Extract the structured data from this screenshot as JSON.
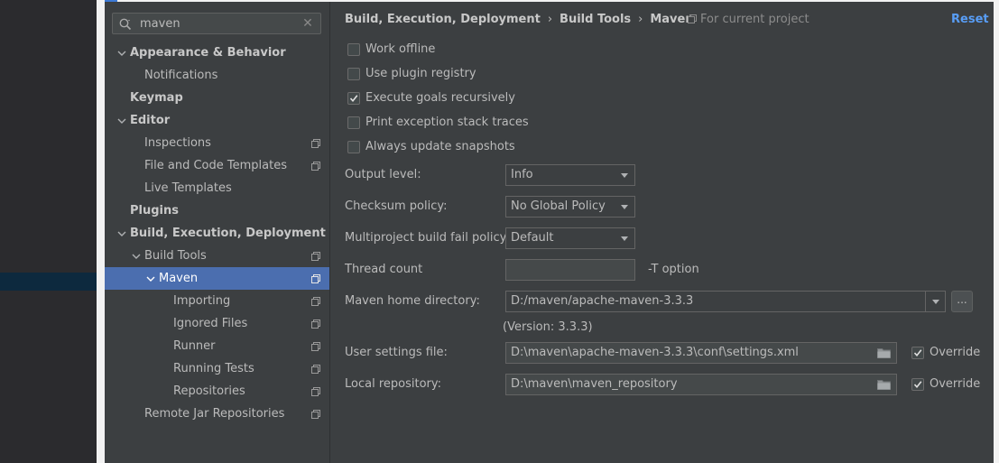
{
  "search": {
    "value": "maven",
    "icon": "search-icon"
  },
  "tree": [
    {
      "label": "Appearance & Behavior",
      "bold": true,
      "expanded": true,
      "depth": 0,
      "shared": false
    },
    {
      "label": "Notifications",
      "bold": false,
      "depth": 1,
      "shared": false
    },
    {
      "label": "Keymap",
      "bold": true,
      "depth": 0,
      "shared": false
    },
    {
      "label": "Editor",
      "bold": true,
      "expanded": true,
      "depth": 0,
      "shared": false
    },
    {
      "label": "Inspections",
      "bold": false,
      "depth": 1,
      "shared": true
    },
    {
      "label": "File and Code Templates",
      "bold": false,
      "depth": 1,
      "shared": true
    },
    {
      "label": "Live Templates",
      "bold": false,
      "depth": 1,
      "shared": false
    },
    {
      "label": "Plugins",
      "bold": true,
      "depth": 0,
      "shared": false
    },
    {
      "label": "Build, Execution, Deployment",
      "bold": true,
      "expanded": true,
      "depth": 0,
      "shared": false
    },
    {
      "label": "Build Tools",
      "bold": false,
      "expanded": true,
      "depth": 1,
      "shared": true
    },
    {
      "label": "Maven",
      "bold": false,
      "expanded": true,
      "depth": 2,
      "shared": true,
      "selected": true
    },
    {
      "label": "Importing",
      "bold": false,
      "depth": 3,
      "shared": true
    },
    {
      "label": "Ignored Files",
      "bold": false,
      "depth": 3,
      "shared": true
    },
    {
      "label": "Runner",
      "bold": false,
      "depth": 3,
      "shared": true
    },
    {
      "label": "Running Tests",
      "bold": false,
      "depth": 3,
      "shared": true
    },
    {
      "label": "Repositories",
      "bold": false,
      "depth": 3,
      "shared": true
    },
    {
      "label": "Remote Jar Repositories",
      "bold": false,
      "depth": 1,
      "shared": true
    }
  ],
  "header": {
    "breadcrumb": [
      "Build, Execution, Deployment",
      "Build Tools",
      "Maven"
    ],
    "for_project": "For current project",
    "reset": "Reset"
  },
  "options": [
    {
      "label": "Work offline",
      "checked": false
    },
    {
      "label": "Use plugin registry",
      "checked": false
    },
    {
      "label": "Execute goals recursively",
      "checked": true
    },
    {
      "label": "Print exception stack traces",
      "checked": false
    },
    {
      "label": "Always update snapshots",
      "checked": false
    }
  ],
  "form": {
    "output_level": {
      "label": "Output level:",
      "value": "Info"
    },
    "checksum_policy": {
      "label": "Checksum policy:",
      "value": "No Global Policy"
    },
    "fail_policy": {
      "label": "Multiproject build fail policy:",
      "value": "Default"
    },
    "thread_count": {
      "label": "Thread count",
      "value": "",
      "suffix": "-T option"
    },
    "maven_home": {
      "label": "Maven home directory:",
      "value": "D:/maven/apache-maven-3.3.3",
      "browse": "...",
      "version": "(Version: 3.3.3)"
    },
    "user_settings": {
      "label": "User settings file:",
      "value": "D:\\maven\\apache-maven-3.3.3\\conf\\settings.xml",
      "override": "Override",
      "override_checked": true
    },
    "local_repo": {
      "label": "Local repository:",
      "value": "D:\\maven\\maven_repository",
      "override": "Override",
      "override_checked": true
    }
  },
  "colors": {
    "selection": "#4b6eaf",
    "link": "#589df6",
    "panel": "#3c3f41"
  }
}
